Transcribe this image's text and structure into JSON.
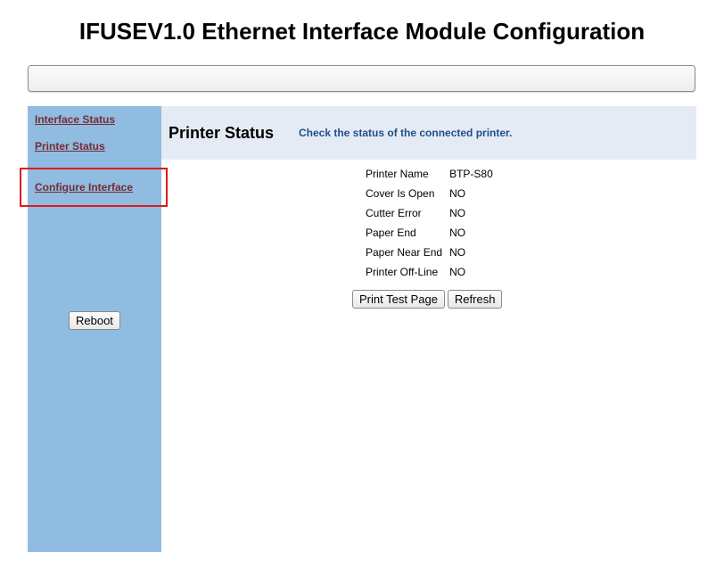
{
  "page": {
    "title": "IFUSEV1.0 Ethernet Interface Module Configuration"
  },
  "sidebar": {
    "links": [
      {
        "label": "Interface Status"
      },
      {
        "label": "Printer Status"
      },
      {
        "label": "Configure Interface"
      }
    ],
    "reboot_label": "Reboot"
  },
  "main": {
    "section_title": "Printer Status",
    "section_description": "Check the status of the connected printer.",
    "status_rows": [
      {
        "label": "Printer Name",
        "value": "BTP-S80"
      },
      {
        "label": "Cover Is Open",
        "value": "NO"
      },
      {
        "label": "Cutter Error",
        "value": "NO"
      },
      {
        "label": "Paper End",
        "value": "NO"
      },
      {
        "label": "Paper Near End",
        "value": "NO"
      },
      {
        "label": "Printer Off-Line",
        "value": "NO"
      }
    ],
    "buttons": {
      "print_test_label": "Print Test Page",
      "refresh_label": "Refresh"
    }
  },
  "colors": {
    "sidebar_bg": "#8fbce0",
    "header_band_bg": "#e5ebf4",
    "link_color": "#7a2a32",
    "description_color": "#1f4f8a",
    "highlight_border": "#e01b1b"
  }
}
